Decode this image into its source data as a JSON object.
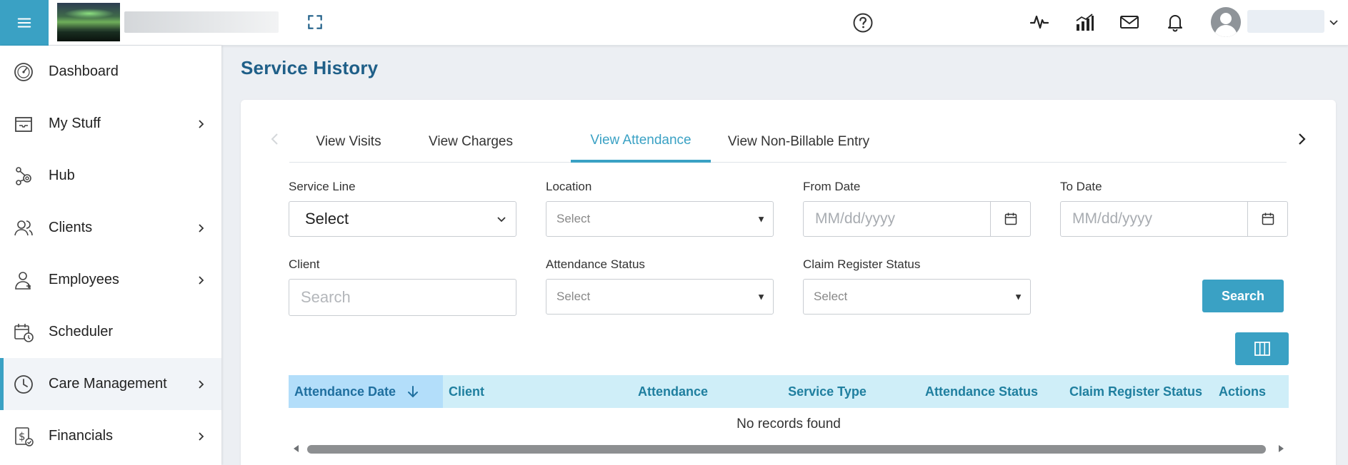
{
  "header": {
    "menu_icon": "hamburger-icon",
    "icons": [
      "expand-icon",
      "help-icon",
      "activity-icon",
      "analytics-icon",
      "mail-icon",
      "bell-icon",
      "user-avatar-icon"
    ]
  },
  "sidebar": {
    "items": [
      {
        "label": "Dashboard",
        "icon": "dashboard-icon",
        "has_children": false
      },
      {
        "label": "My Stuff",
        "icon": "inbox-icon",
        "has_children": true
      },
      {
        "label": "Hub",
        "icon": "hub-icon",
        "has_children": false
      },
      {
        "label": "Clients",
        "icon": "clients-icon",
        "has_children": true
      },
      {
        "label": "Employees",
        "icon": "employees-icon",
        "has_children": true
      },
      {
        "label": "Scheduler",
        "icon": "scheduler-icon",
        "has_children": false
      },
      {
        "label": "Care Management",
        "icon": "clock-icon",
        "has_children": true,
        "active": true
      },
      {
        "label": "Financials",
        "icon": "financials-icon",
        "has_children": true
      }
    ]
  },
  "page": {
    "title": "Service History"
  },
  "tabs": [
    {
      "label": "View Visits"
    },
    {
      "label": "View Charges"
    },
    {
      "label": "View Attendance",
      "active": true
    },
    {
      "label": "View Non-Billable Entry"
    }
  ],
  "filters": {
    "service_line": {
      "label": "Service Line",
      "value": "Select"
    },
    "location": {
      "label": "Location",
      "value": "Select"
    },
    "from_date": {
      "label": "From Date",
      "placeholder": "MM/dd/yyyy"
    },
    "to_date": {
      "label": "To Date",
      "placeholder": "MM/dd/yyyy"
    },
    "client": {
      "label": "Client",
      "placeholder": "Search"
    },
    "attendance_status": {
      "label": "Attendance Status",
      "value": "Select"
    },
    "claim_register_status": {
      "label": "Claim Register Status",
      "value": "Select"
    },
    "search_button": "Search"
  },
  "grid": {
    "columns": [
      "Attendance Date",
      "Client",
      "Attendance",
      "Service Type",
      "Attendance Status",
      "Claim Register Status",
      "Actions"
    ],
    "sorted_column": "Attendance Date",
    "sort_direction": "descending",
    "empty_message": "No records found"
  },
  "colors": {
    "accent": "#3aa1c4",
    "title": "#1f5f88",
    "grid_header_bg": "#cfeef8",
    "grid_header_text": "#1f7f9f"
  }
}
